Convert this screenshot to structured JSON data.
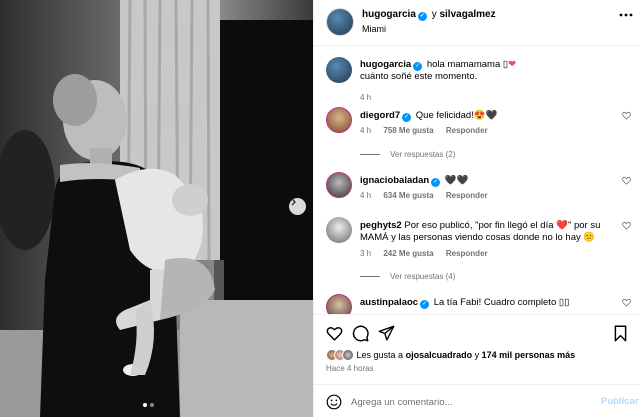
{
  "header": {
    "username": "hugogarcia",
    "and_text": "y",
    "coauthor": "silvagalmez",
    "location": "Miami"
  },
  "caption": {
    "username": "hugogarcia",
    "text_line1": "hola mamamama ▯",
    "text_line2": "cuánto soñé este momento.",
    "time": "4 h"
  },
  "comments": [
    {
      "username": "diegord7",
      "text": "Que felicidad!😍🖤",
      "time": "4 h",
      "likes": "758 Me gusta",
      "reply": "Responder",
      "view_replies": "Ver respuestas (2)"
    },
    {
      "username": "ignaciobaladan",
      "text": "🖤🖤",
      "time": "4 h",
      "likes": "634 Me gusta",
      "reply": "Responder",
      "view_replies": ""
    },
    {
      "username": "peghyts2",
      "text": "Por eso publicó, \"por fin llegó el día ❤️\" por su MAMÁ y las personas viendo cosas donde no lo hay 😕",
      "time": "3 h",
      "likes": "242 Me gusta",
      "reply": "Responder",
      "view_replies": "Ver respuestas (4)"
    },
    {
      "username": "austinpalaoc",
      "text": "La tía Fabi! Cuadro completo ▯▯",
      "time": "",
      "likes": "",
      "reply": "",
      "view_replies": ""
    }
  ],
  "likes": {
    "prefix": "Les gusta a",
    "user": "ojosalcuadrado",
    "connector": "y",
    "count": "174 mil personas más"
  },
  "posted_time": "Hace 4 horas",
  "add_comment": {
    "placeholder": "Agrega un comentario...",
    "publish_label": "Publicar"
  },
  "carousel": {
    "current": 1,
    "total": 2
  },
  "icons": [
    "more-icon",
    "verified-icon",
    "heart-icon",
    "comment-icon",
    "share-icon",
    "bookmark-icon",
    "emoji-icon",
    "next-arrow-icon"
  ],
  "colors": {
    "verified": "#0095f6",
    "heart": "#ed4956",
    "muted": "#737373",
    "publish_disabled": "#b3dbff"
  }
}
